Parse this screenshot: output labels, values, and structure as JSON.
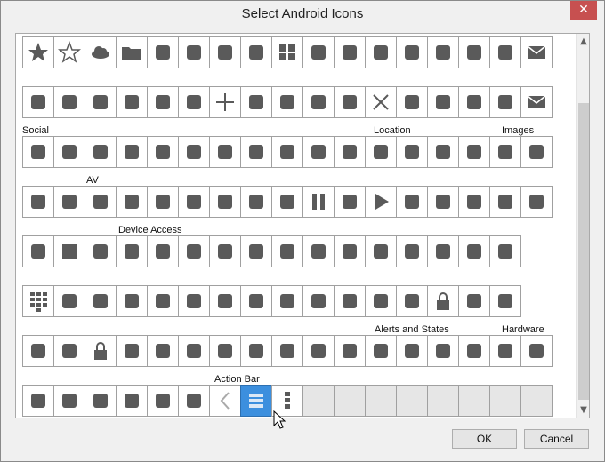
{
  "window": {
    "title": "Select Android Icons",
    "close_glyph": "✕"
  },
  "groups": {
    "social": "Social",
    "location": "Location",
    "images": "Images",
    "av": "AV",
    "device_access": "Device Access",
    "alerts_and_states": "Alerts and States",
    "hardware": "Hardware",
    "action_bar": "Action Bar"
  },
  "buttons": {
    "ok": "OK",
    "cancel": "Cancel"
  },
  "icon_rows": [
    [
      "star-filled",
      "star-outline",
      "cloud",
      "folder",
      "calendar",
      "tag",
      "tag-add",
      "sort-lines",
      "grid-view",
      "list-doc",
      "paperclip",
      "backspace",
      "copy",
      "cut",
      "trash",
      "pencil",
      "mail"
    ],
    [
      "calendar-add",
      "sort-updown",
      "merge",
      "paperclip-add",
      "mail-add",
      "comment-add",
      "plus",
      "picture-add",
      "clipboard",
      "picture",
      "inbox",
      "close",
      "save",
      "select-all",
      "split",
      "undo",
      "email"
    ],
    [
      "group-add",
      "person-add",
      "group",
      "chat",
      "forward",
      "group-people",
      "person",
      "reply-all",
      "reply",
      "send",
      "share",
      "directions",
      "map",
      "place",
      "globe",
      "crop",
      "rotate"
    ],
    [
      "replay",
      "video-play",
      "add-to-queue",
      "download",
      "fast-forward",
      "full-screen",
      "pin",
      "next",
      "pause-circle",
      "pause",
      "play-circle",
      "play",
      "previous",
      "repeat",
      "refresh",
      "return-from-full-screen",
      "rewind"
    ],
    [
      "shuffle",
      "stop",
      "upload",
      "key",
      "add-alarm",
      "alarm",
      "battery",
      "brightness-high",
      "bluetooth",
      "bluetooth-searching",
      "bluetooth-connected",
      "brightness-auto",
      "brightness-low",
      "call",
      "camera",
      "data-usage"
    ],
    [
      "dial-pad",
      "end-call",
      "flash-auto",
      "flash-off",
      "flash-on",
      "gps-fixed",
      "gps-not-fixed",
      "gps-off",
      "mic-off",
      "mic",
      "signal",
      "wifi",
      "key-add",
      "lock",
      "ring-volume",
      "screen-rotation"
    ],
    [
      "screen-rotation-lock",
      "sd-card",
      "lock-closed",
      "storage",
      "switch-camera",
      "switch-video",
      "clock",
      "usb",
      "video",
      "volume-muted",
      "volume-on",
      "airplane-mode",
      "airplane",
      "error",
      "warning",
      "computer",
      "desktop"
    ],
    [
      "phone",
      "headphones",
      "headset",
      "keyboard",
      "mouse",
      "phone-android",
      "previous-item",
      "overflow",
      "overflow-vertical",
      "",
      "",
      "",
      "",
      "",
      "",
      "",
      ""
    ]
  ],
  "selected_icon": "overflow"
}
